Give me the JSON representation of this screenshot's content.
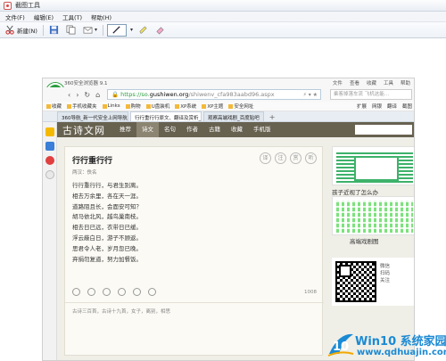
{
  "window": {
    "title": "截图工具"
  },
  "menu": [
    "文件(F)",
    "编辑(E)",
    "工具(T)",
    "帮助(H)"
  ],
  "toolbar": {
    "new_label": "新建(N)"
  },
  "browser": {
    "title": "360安全浏览器 9.1",
    "title_right": [
      "文件",
      "查看",
      "收藏",
      "工具",
      "帮助"
    ],
    "url_https": "https://so.",
    "url_domain": "gushiwen.org",
    "url_path": "/shiwenv_cfa983aabd96.aspx",
    "search_placeholder": "乘客掉落车流 飞机这能…",
    "bookmarks": [
      "收藏",
      "手机收藏夹",
      "Links",
      "购物",
      "U盘装机",
      "XP系统",
      "XP主题",
      "安全网址"
    ],
    "bookmarks_right": [
      "扩展",
      "网银",
      "翻译",
      "截图"
    ],
    "tabs": [
      "360导航_新一代安全上网导航",
      "行行重行行原文、翻译及赏析_古...",
      "观察高端戏剧_百度贴吧"
    ]
  },
  "site": {
    "logo": "古诗文网",
    "nav": [
      "推荐",
      "诗文",
      "名句",
      "作者",
      "古籍",
      "收藏",
      "手机版"
    ],
    "active_nav": "诗文"
  },
  "poem": {
    "title": "行行重行行",
    "author": "两汉：佚名",
    "circles": [
      "译",
      "注",
      "赏",
      "听"
    ],
    "lines": [
      "行行重行行，与君生别离。",
      "相去万余里，各在天一涯。",
      "道路阻且长，会面安可知？",
      "胡马依北风，越鸟巢南枝。",
      "相去日已远，衣带日已缓。",
      "浮云蔽白日，游子不顾返。",
      "思君令人老，岁月忽已晚。",
      "弃捐勿复道，努力加餐饭。"
    ],
    "like_count": "1008",
    "tags": "古诗三百首，古诗十九首，女子，离别，相思"
  },
  "sidebar_ads": {
    "caption1": "孩子近视了怎么办",
    "caption2": "高端戏剧图",
    "qr_text": [
      "微信",
      "扫码",
      "关注"
    ]
  },
  "watermark": {
    "main": "Win10 系统家园",
    "sub": "www.qdhuajin.com",
    "badge": "10"
  }
}
